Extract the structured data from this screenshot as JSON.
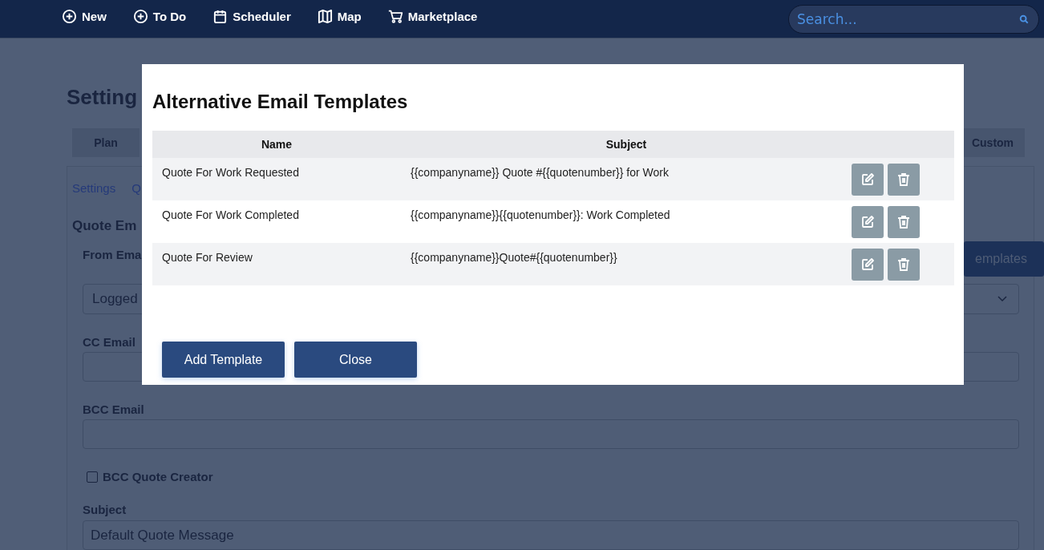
{
  "nav": {
    "items": [
      {
        "label": "New",
        "kind": "plus"
      },
      {
        "label": "To Do",
        "kind": "plus"
      },
      {
        "label": "Scheduler",
        "kind": "calendar"
      },
      {
        "label": "Map",
        "kind": "map"
      },
      {
        "label": "Marketplace",
        "kind": "cart"
      }
    ],
    "search": {
      "placeholder": "Search..."
    }
  },
  "page": {
    "title": "Setting",
    "tabs": [
      {
        "label": "Plan"
      },
      {
        "label": "Custom"
      }
    ],
    "breadcrumbs": [
      "Settings",
      "Q"
    ],
    "section_title": "Quote Em",
    "from_label": "From Ema",
    "from_value": "Logged",
    "templates_button": "emplates",
    "cc_label": "CC Email",
    "bcc_label": "BCC Email",
    "bcc_creator": {
      "label": "BCC Quote Creator",
      "checked": false
    },
    "subject_label": "Subject",
    "subject_value": "Default Quote Message"
  },
  "modal": {
    "title": "Alternative Email Templates",
    "columns": [
      "Name",
      "Subject"
    ],
    "rows": [
      {
        "name": "Quote For Work Requested",
        "subject": "{{companyname}} Quote #{{quotenumber}} for Work"
      },
      {
        "name": "Quote For Work Completed",
        "subject": "{{companyname}}{{quotenumber}}: Work Completed"
      },
      {
        "name": "Quote For Review",
        "subject": "{{companyname}}Quote#{{quotenumber}}"
      }
    ],
    "buttons": [
      "Add Template",
      "Close"
    ]
  }
}
